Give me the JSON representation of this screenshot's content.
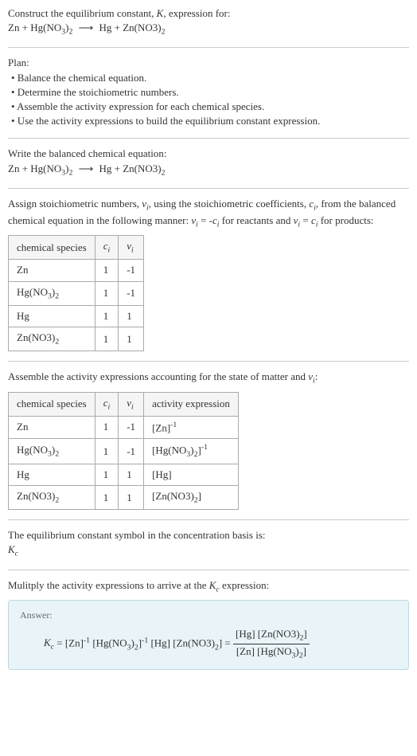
{
  "intro": {
    "line1": "Construct the equilibrium constant, K, expression for:",
    "equation": "Zn + Hg(NO₃)₂  ⟶  Hg + Zn(NO3)₂"
  },
  "plan": {
    "heading": "Plan:",
    "items": [
      "• Balance the chemical equation.",
      "• Determine the stoichiometric numbers.",
      "• Assemble the activity expression for each chemical species.",
      "• Use the activity expressions to build the equilibrium constant expression."
    ]
  },
  "balanced": {
    "heading": "Write the balanced chemical equation:",
    "equation": "Zn + Hg(NO₃)₂  ⟶  Hg + Zn(NO3)₂"
  },
  "stoich": {
    "text": "Assign stoichiometric numbers, νᵢ, using the stoichiometric coefficients, cᵢ, from the balanced chemical equation in the following manner: νᵢ = -cᵢ for reactants and νᵢ = cᵢ for products:",
    "headers": [
      "chemical species",
      "cᵢ",
      "νᵢ"
    ],
    "rows": [
      {
        "species": "Zn",
        "c": "1",
        "v": "-1"
      },
      {
        "species": "Hg(NO₃)₂",
        "c": "1",
        "v": "-1"
      },
      {
        "species": "Hg",
        "c": "1",
        "v": "1"
      },
      {
        "species": "Zn(NO3)₂",
        "c": "1",
        "v": "1"
      }
    ]
  },
  "activity": {
    "text": "Assemble the activity expressions accounting for the state of matter and νᵢ:",
    "headers": [
      "chemical species",
      "cᵢ",
      "νᵢ",
      "activity expression"
    ],
    "rows": [
      {
        "species": "Zn",
        "c": "1",
        "v": "-1",
        "expr": "[Zn]⁻¹"
      },
      {
        "species": "Hg(NO₃)₂",
        "c": "1",
        "v": "-1",
        "expr": "[Hg(NO₃)₂]⁻¹"
      },
      {
        "species": "Hg",
        "c": "1",
        "v": "1",
        "expr": "[Hg]"
      },
      {
        "species": "Zn(NO3)₂",
        "c": "1",
        "v": "1",
        "expr": "[Zn(NO3)₂]"
      }
    ]
  },
  "symbol": {
    "line1": "The equilibrium constant symbol in the concentration basis is:",
    "line2": "K_c"
  },
  "multiply": {
    "text": "Mulitply the activity expressions to arrive at the K_c expression:"
  },
  "answer": {
    "label": "Answer:",
    "lhs": "K_c = [Zn]⁻¹ [Hg(NO₃)₂]⁻¹ [Hg] [Zn(NO3)₂] = ",
    "num": "[Hg] [Zn(NO3)₂]",
    "den": "[Zn] [Hg(NO₃)₂]"
  },
  "chart_data": {
    "type": "table",
    "tables": [
      {
        "name": "stoichiometric numbers",
        "columns": [
          "chemical species",
          "c_i",
          "nu_i"
        ],
        "rows": [
          [
            "Zn",
            1,
            -1
          ],
          [
            "Hg(NO3)2",
            1,
            -1
          ],
          [
            "Hg",
            1,
            1
          ],
          [
            "Zn(NO3)2",
            1,
            1
          ]
        ]
      },
      {
        "name": "activity expressions",
        "columns": [
          "chemical species",
          "c_i",
          "nu_i",
          "activity expression"
        ],
        "rows": [
          [
            "Zn",
            1,
            -1,
            "[Zn]^-1"
          ],
          [
            "Hg(NO3)2",
            1,
            -1,
            "[Hg(NO3)2]^-1"
          ],
          [
            "Hg",
            1,
            1,
            "[Hg]"
          ],
          [
            "Zn(NO3)2",
            1,
            1,
            "[Zn(NO3)2]"
          ]
        ]
      }
    ]
  }
}
